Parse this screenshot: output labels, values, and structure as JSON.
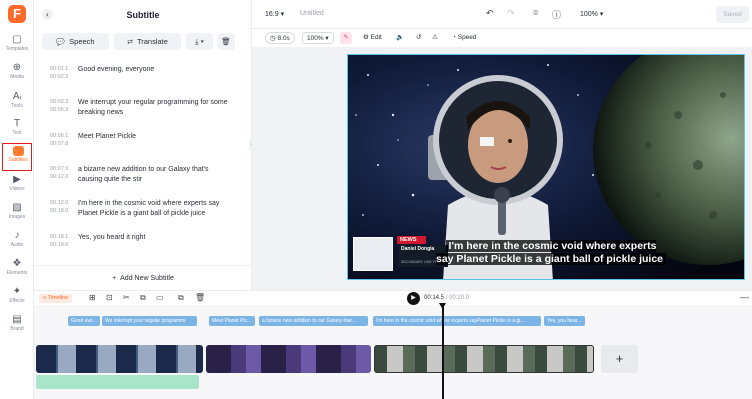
{
  "app": {
    "logo_letter": "F"
  },
  "rail": {
    "items": [
      {
        "label": "Templates",
        "icon": "templates-icon",
        "glyph": "▢"
      },
      {
        "label": "Media",
        "icon": "media-icon",
        "glyph": "⊕"
      },
      {
        "label": "Tools",
        "icon": "tools-icon",
        "glyph": "Aᵢ"
      },
      {
        "label": "Text",
        "icon": "text-icon",
        "glyph": "T"
      },
      {
        "label": "Subtitles",
        "icon": "subtitles-icon",
        "glyph": ""
      },
      {
        "label": "Videos",
        "icon": "videos-icon",
        "glyph": "▶"
      },
      {
        "label": "Images",
        "icon": "images-icon",
        "glyph": "▨"
      },
      {
        "label": "Audio",
        "icon": "audio-icon",
        "glyph": "♪"
      },
      {
        "label": "Elements",
        "icon": "elements-icon",
        "glyph": "❖"
      },
      {
        "label": "Effects",
        "icon": "effects-icon",
        "glyph": "✦"
      },
      {
        "label": "Brand",
        "icon": "brand-icon",
        "glyph": "▤"
      }
    ]
  },
  "panel": {
    "title": "Subtitle",
    "speech_label": "Speech",
    "translate_label": "Translate",
    "add_label": "Add New Subtitle",
    "subtitles": [
      {
        "start": "00:01.1",
        "end": "00:02.3",
        "text": "Good evening, everyone"
      },
      {
        "start": "00:02.3",
        "end": "00:05.9",
        "text": "We interrupt your regular programming for some breaking news"
      },
      {
        "start": "00:06.1",
        "end": "00:07.8",
        "text": "Meet Planet Pickle"
      },
      {
        "start": "00:07.9",
        "end": "00:12.0",
        "text": "a bizarre new addition to our Galaxy that's causing quite the stir"
      },
      {
        "start": "00:12.0",
        "end": "00:18.0",
        "text": "I'm here in the cosmic void where experts say Planet Pickle is a giant ball of pickle juice"
      },
      {
        "start": "00:18.1",
        "end": "00:19.6",
        "text": "Yes, you heard it right"
      }
    ]
  },
  "topbar": {
    "aspect": "16:9",
    "project_name": "Untitled",
    "zoom": "100%",
    "saved_label": "Saved"
  },
  "edit_toolbar": {
    "duration": "8.0s",
    "scale": "100%",
    "edit_label": "Edit",
    "speed_label": "Speed"
  },
  "video": {
    "news_tag": "NEWS",
    "anchor_name": "Daniel Dongia",
    "anchor_sub": "SECONDARY LINE FOR",
    "caption": "I'm here in the cosmic void where experts say Planet Pickle is a giant ball of pickle juice"
  },
  "timeline": {
    "tag": "Timeline",
    "current_time": "00:14.5",
    "total_time": "/ 00:20.0",
    "chips": [
      "Good eve...",
      "We interrupt your regular programmi",
      "Meet Planet Pic...",
      "a bizarre new addition to our Galaxy that...",
      "I'm here in the cosmic void where experts sayPlanet Pickle is a gi...",
      "Yes, you hear..."
    ],
    "add_clip": "+"
  },
  "colors": {
    "brand": "#ff6a2b",
    "selection": "#59c7e8",
    "chip": "#7db4e6",
    "audio": "#a9e6c9"
  }
}
